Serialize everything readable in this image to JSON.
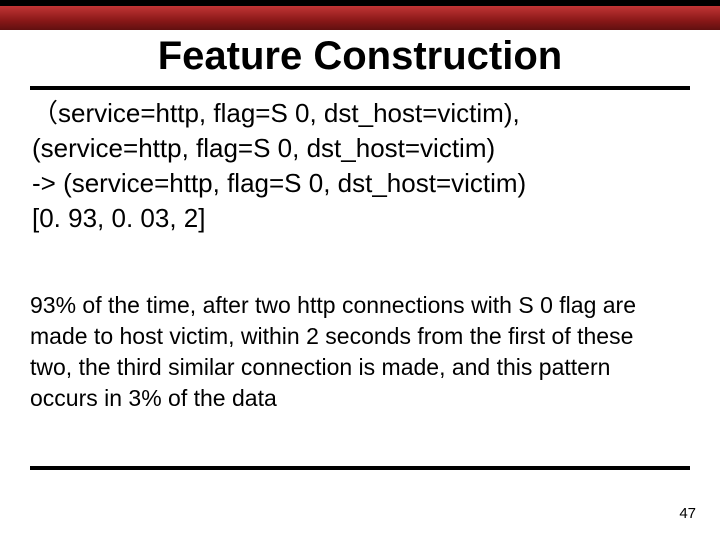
{
  "title": "Feature Construction",
  "rule": {
    "line1": "（service=http, flag=S 0, dst_host=victim),",
    "line2": "(service=http, flag=S 0, dst_host=victim)",
    "line3": "-> (service=http, flag=S 0, dst_host=victim)",
    "line4": "[0. 93, 0. 03, 2]"
  },
  "explanation": "93% of the time, after two http connections with S 0 flag are made to host victim, within 2 seconds from the first of these two, the third similar connection is made, and this pattern occurs in 3% of the data",
  "page_number": "47"
}
